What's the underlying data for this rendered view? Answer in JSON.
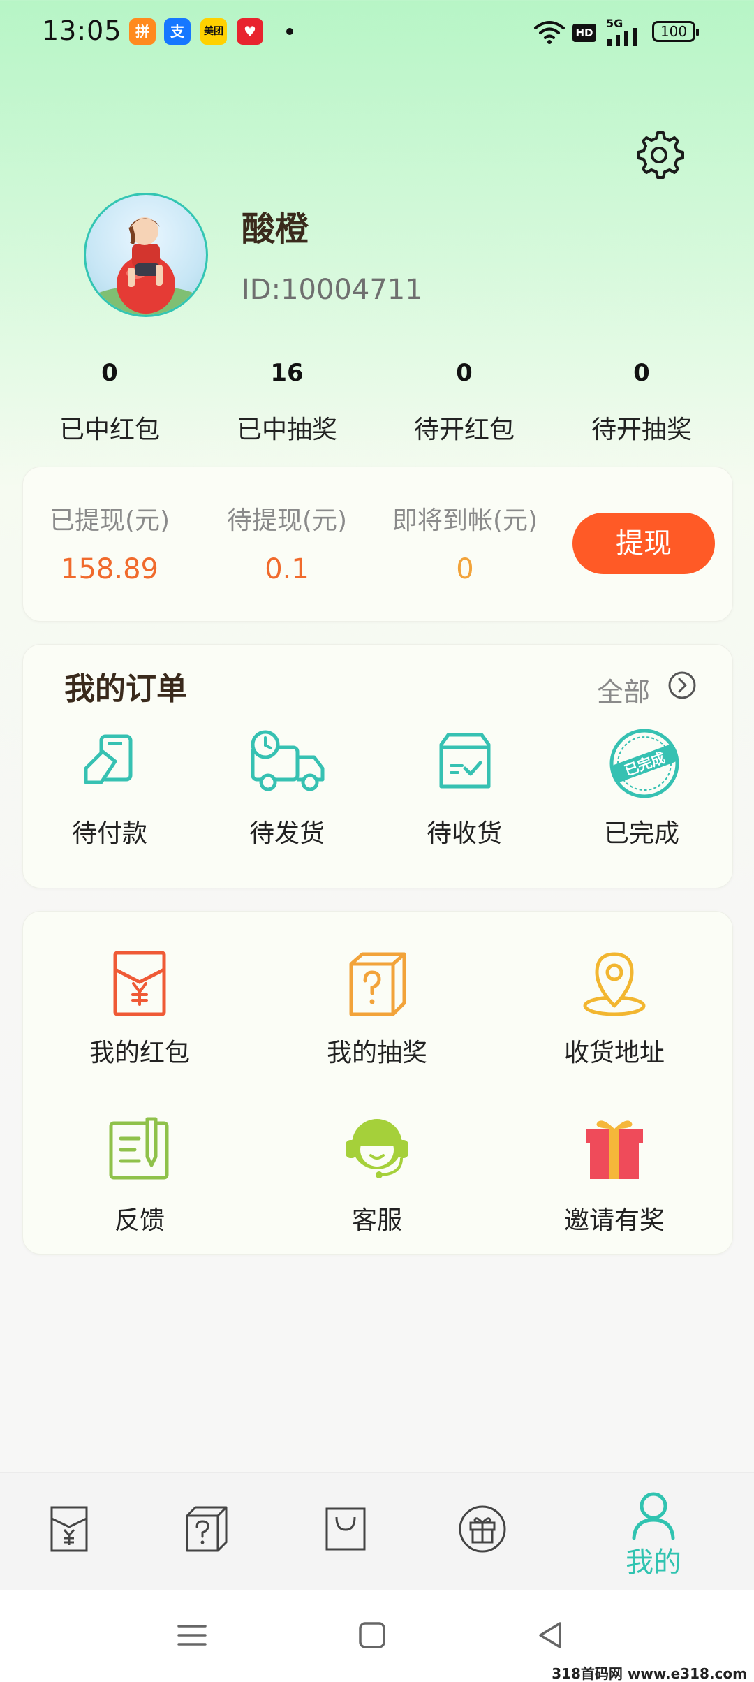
{
  "status_bar": {
    "time": "13:05",
    "apps": [
      "拼",
      "支",
      "美团",
      "♥"
    ],
    "network": "5G",
    "hd": "HD",
    "battery": "100"
  },
  "profile": {
    "username": "酸橙",
    "user_id": "ID:10004711",
    "icons": {
      "settings": "gear-icon"
    }
  },
  "stats": [
    {
      "value": "0",
      "label": "已中红包"
    },
    {
      "value": "16",
      "label": "已中抽奖"
    },
    {
      "value": "0",
      "label": "待开红包"
    },
    {
      "value": "0",
      "label": "待开抽奖"
    }
  ],
  "wallet": {
    "items": [
      {
        "label": "已提现(元)",
        "value": "158.89",
        "color": "#f06a2c"
      },
      {
        "label": "待提现(元)",
        "value": "0.1",
        "color": "#f06a2c"
      },
      {
        "label": "即将到帐(元)",
        "value": "0",
        "color": "#f2a33a"
      }
    ],
    "button": "提现",
    "button_color": "#ff5a26"
  },
  "orders": {
    "title": "我的订单",
    "all_label": "全部",
    "items": [
      {
        "label": "待付款",
        "icon": "payment-icon"
      },
      {
        "label": "待发货",
        "icon": "delivery-truck-icon"
      },
      {
        "label": "待收货",
        "icon": "package-box-icon"
      },
      {
        "label": "已完成",
        "icon": "completed-stamp-icon",
        "stamp_text": "已完成"
      }
    ],
    "accent": "#36c1b2"
  },
  "services": [
    {
      "label": "我的红包",
      "icon": "red-envelope-icon",
      "color": "#ef5a36"
    },
    {
      "label": "我的抽奖",
      "icon": "mystery-box-icon",
      "color": "#f2a33a"
    },
    {
      "label": "收货地址",
      "icon": "location-pin-icon",
      "color": "#f2b630"
    },
    {
      "label": "反馈",
      "icon": "feedback-icon",
      "color": "#8fc14a"
    },
    {
      "label": "客服",
      "icon": "customer-service-icon",
      "color": "#a5d03a"
    },
    {
      "label": "邀请有奖",
      "icon": "gift-icon",
      "color": "#ef4b5a"
    }
  ],
  "bottom_nav": {
    "items": [
      {
        "icon": "red-envelope-icon"
      },
      {
        "icon": "mystery-box-icon"
      },
      {
        "icon": "shopping-bag-icon"
      },
      {
        "icon": "gift-icon"
      }
    ],
    "active_label": "我的",
    "active_color": "#30c3b0"
  },
  "system_nav": {
    "icons": [
      "menu-icon",
      "home-icon",
      "back-icon"
    ]
  },
  "watermark": "318首码网 www.e318.com"
}
